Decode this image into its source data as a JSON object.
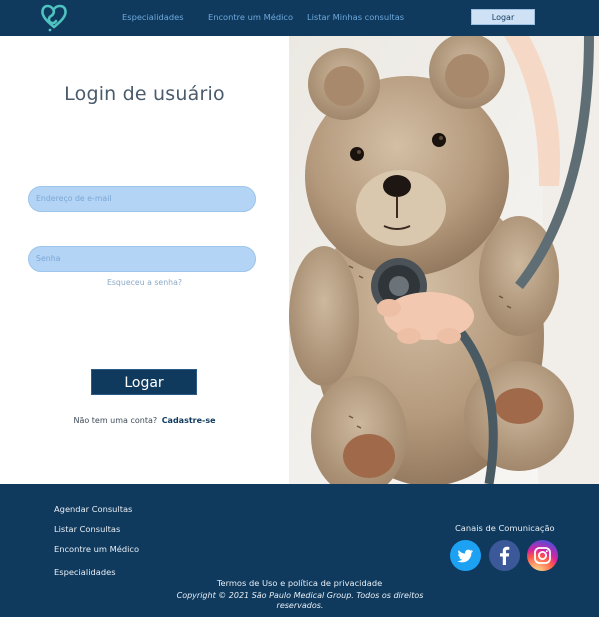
{
  "header": {
    "logo_icon": "heart-stethoscope-icon",
    "nav": [
      "Especialidades",
      "Encontre um Médico",
      "Listar Minhas consultas"
    ],
    "login_button": "Logar"
  },
  "login": {
    "title": "Login de usuário",
    "email_placeholder": "Endereço de e-mail",
    "password_placeholder": "Senha",
    "forgot": "Esqueceu a senha?",
    "submit": "Logar",
    "no_account": "Não tem uma conta?",
    "signup": "Cadastre-se"
  },
  "footer": {
    "links": [
      "Agendar Consultas",
      "Listar Consultas",
      "Encontre um Médico",
      "Especialidades"
    ],
    "canais_title": "Canais de Comunicação",
    "social": [
      "twitter-icon",
      "facebook-icon",
      "instagram-icon"
    ],
    "terms": "Termos de Uso e política de privacidade",
    "copyright": "Copyright © 2021 São Paulo Medical Group. Todos os direitos reservados."
  },
  "colors": {
    "primary": "#0f3a5e",
    "accent": "#6ea8dc",
    "field": "#b3d4f5",
    "logo": "#4fc3c0"
  }
}
